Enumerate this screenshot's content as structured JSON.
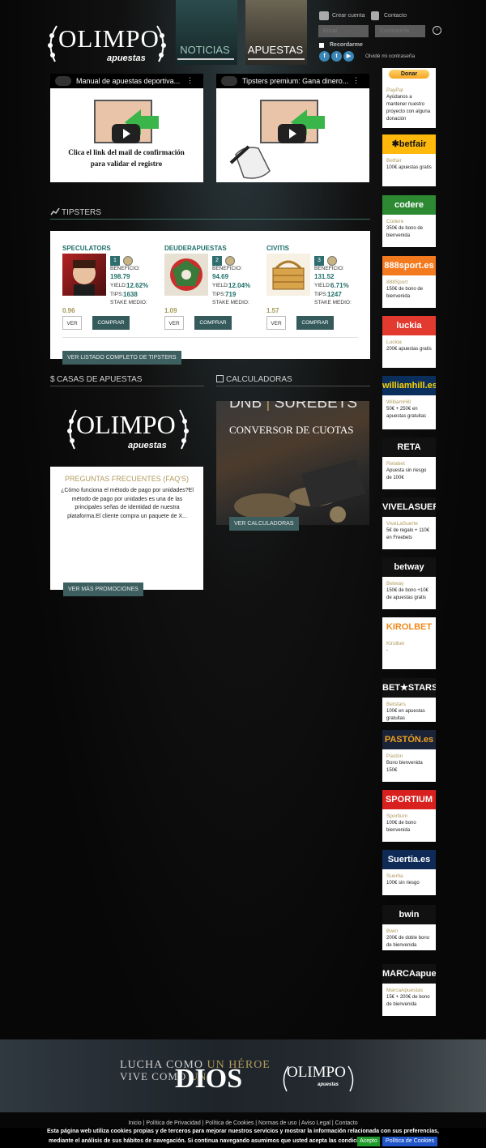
{
  "header": {
    "logo_word": "OLIMPO",
    "logo_sub": "apuestas",
    "nav": [
      {
        "label": "NOTICIAS"
      },
      {
        "label": "APUESTAS"
      }
    ],
    "create_account": "Crear cuenta",
    "contact": "Contacto",
    "email_placeholder": "Email",
    "password_placeholder": "Contraseña",
    "remember": "Recordarme",
    "forgot": "Olvidé mi contraseña"
  },
  "videos": [
    {
      "title": "Manual de apuestas deportiva...",
      "caption_line1": "Clica el link del mail de confirmación",
      "caption_line2": "para validar el registro"
    },
    {
      "title": "Tipsters premium: Gana dinero..."
    }
  ],
  "tipsters": {
    "section_title": "TIPSTERS",
    "labels": {
      "beneficio": "BENEFICIO:",
      "yield": "YIELD:",
      "tips": "TIPS:",
      "stake": "STAKE MEDIO:"
    },
    "ver": "VER",
    "comprar": "COMPRAR",
    "all_button": "VER LISTADO COMPLETO DE TIPSTERS",
    "items": [
      {
        "name": "SPECULATORS",
        "rank": "1",
        "beneficio": "198.79",
        "yield": "12.62%",
        "tips": "1638",
        "stake": "0.96"
      },
      {
        "name": "DEUDERAPUESTAS",
        "rank": "2",
        "beneficio": "94.69",
        "yield": "12.04%",
        "tips": "719",
        "stake": "1.09"
      },
      {
        "name": "CIVITIS",
        "rank": "3",
        "beneficio": "131.52",
        "yield": "6.71%",
        "tips": "1247",
        "stake": "1.57"
      }
    ]
  },
  "casas": {
    "section_title": "CASAS DE APUESTAS",
    "faq_title": "PREGUNTAS FRECUENTES (FAQ'S)",
    "faq_text": "¿Cómo funciona el método de pago por unidades?El método de pago por unidades es una de las principales señas de identidad de nuestra plataforma.El cliente compra un paquete de X...",
    "more_button": "VER MÁS PROMOCIONES"
  },
  "calculadoras": {
    "section_title": "CALCULADORAS",
    "dnb": "DNB",
    "surebets": "SUREBETS",
    "conversor": "CONVERSOR DE CUOTAS",
    "button": "VER CALCULADORAS"
  },
  "sidebar": {
    "donate_button": "Donar",
    "items": [
      {
        "logo": "PayPal",
        "name": "PayPal",
        "desc": "Ayúdanos a mantener nuestro proyecto con alguna donación",
        "bg": "#ffffff",
        "fg": "#2a5bb0"
      },
      {
        "logo": "✱betfair",
        "name": "Betfair",
        "desc": "100€ apuestas gratis",
        "bg": "#ffb80c",
        "fg": "#111111"
      },
      {
        "logo": "codere",
        "name": "Codere",
        "desc": "350€ de bono de bienvenida",
        "bg": "#2d8a33",
        "fg": "#ffffff"
      },
      {
        "logo": "888sport.es",
        "name": "888Sport",
        "desc": "150€ de bono de bienvenida",
        "bg": "#f47a20",
        "fg": "#ffffff"
      },
      {
        "logo": "luckia",
        "name": "Luckia",
        "desc": "200€ apuestas gratis",
        "bg": "#e23a2f",
        "fg": "#ffffff"
      },
      {
        "logo": "williamhill.es",
        "name": "WilliamHill",
        "desc": "50€ + 250€ en apuestas gratuitas",
        "bg": "#0a2f5c",
        "fg": "#ffd200"
      },
      {
        "logo": "RETA",
        "name": "Retabet",
        "desc": "Apuesta sin riesgo de 100€",
        "bg": "#111111",
        "fg": "#ffffff"
      },
      {
        "logo": "VIVELASUERTE.es",
        "name": "ViveLaSuerte",
        "desc": "5€ de regalo + 110€ en Freebets",
        "bg": "#111111",
        "fg": "#ffffff"
      },
      {
        "logo": "betway",
        "name": "Betway",
        "desc": "150€ de bono +10€ de apuestas gratis",
        "bg": "#111111",
        "fg": "#ffffff"
      },
      {
        "logo": "KIROLBET",
        "name": "Kirolbet",
        "desc": "-",
        "bg": "#ffffff",
        "fg": "#f08a1c"
      },
      {
        "logo": "BET★STARS",
        "name": "Betstars",
        "desc": "100€ en apuestas gratuitas",
        "bg": "#111111",
        "fg": "#ffffff"
      },
      {
        "logo": "PASTÓN.es",
        "name": "Pastón",
        "desc": "Bono bienvenida 150€",
        "bg": "#1a2338",
        "fg": "#f0a020"
      },
      {
        "logo": "SPORTIUM",
        "name": "Sportium",
        "desc": "100€ de bono bienvenida",
        "bg": "#d8201f",
        "fg": "#ffffff"
      },
      {
        "logo": "Suertia.es",
        "name": "Suertia",
        "desc": "100€ sin riesgo",
        "bg": "#0f2a57",
        "fg": "#ffffff"
      },
      {
        "logo": "bwin",
        "name": "Bwin",
        "desc": "200€ de doble bono de bienvenida",
        "bg": "#111111",
        "fg": "#ffffff"
      },
      {
        "logo": "MARCAapuestas.es",
        "name": "MarcaApuestas",
        "desc": "15€ + 200€ de bono de bienvenida",
        "bg": "#111111",
        "fg": "#ffffff"
      }
    ]
  },
  "footer": {
    "lucha_pre": "LUCHA COMO ",
    "lucha_hl": "UN HÉROE",
    "vive_pre": "VIVE COMO ",
    "vive_hl": "UN",
    "dios": "DIOS",
    "logo_word": "OLIMPO",
    "logo_sub": "apuestas",
    "links": "Inicio | Política de Privacidad | Política de Cookies | Normas de uso | Aviso Legal | Contacto",
    "cookie_line1": "Esta página web utiliza cookies propias y de terceros para mejorar nuestros servicios y mostrar la información relacionada con sus preferencias,",
    "cookie_line2": "mediante el análisis de sus hábitos de navegación. Si continua navegando asumimos que usted acepta las condiciones.",
    "accept": "Acepto",
    "policy": "Política de Cookies"
  }
}
